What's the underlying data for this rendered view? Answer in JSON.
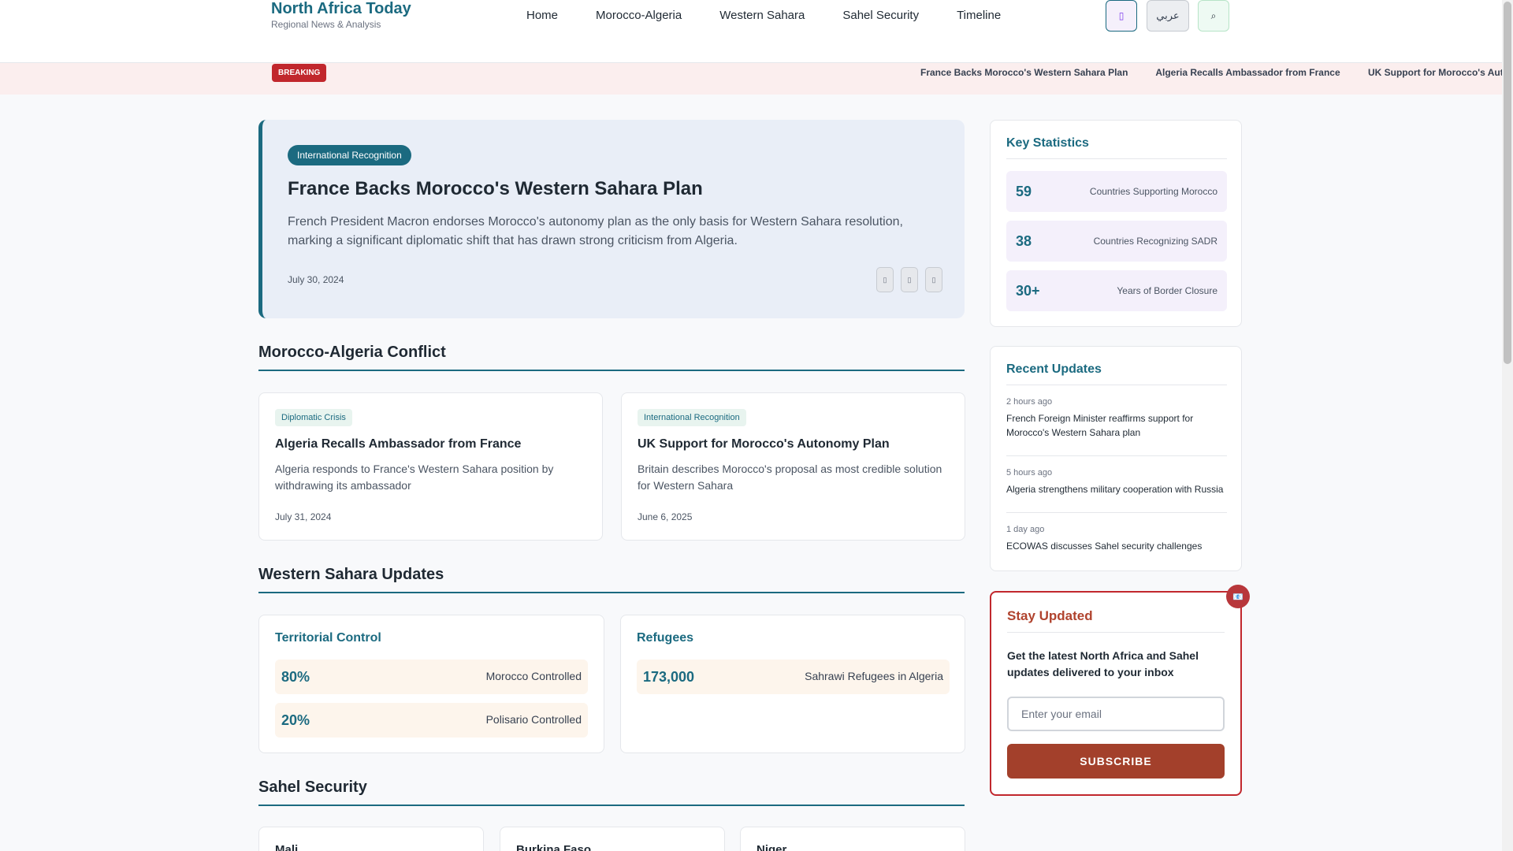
{
  "brand": {
    "title": "North Africa Today",
    "tagline": "Regional News & Analysis"
  },
  "nav": [
    "Home",
    "Morocco-Algeria",
    "Western Sahara",
    "Sahel Security",
    "Timeline"
  ],
  "header_buttons": {
    "theme_icon": "▯",
    "language": "عربي",
    "search_icon": "⌕"
  },
  "breaking": {
    "label": "BREAKING",
    "items": [
      "France Backs Morocco's Western Sahara Plan",
      "Algeria Recalls Ambassador from France",
      "UK Support for Morocco's Autonomy Plan"
    ]
  },
  "hero": {
    "tag": "International Recognition",
    "title": "France Backs Morocco's Western Sahara Plan",
    "description": "French President Macron endorses Morocco's autonomy plan as the only basis for Western Sahara resolution, marking a significant diplomatic shift that has drawn strong criticism from Algeria.",
    "date": "July 30, 2024",
    "share_icons": [
      "▯",
      "▯",
      "▯"
    ]
  },
  "conflict": {
    "title": "Morocco-Algeria Conflict",
    "cards": [
      {
        "tag": "Diplomatic Crisis",
        "title": "Algeria Recalls Ambassador from France",
        "desc": "Algeria responds to France's Western Sahara position by withdrawing its ambassador",
        "date": "July 31, 2024"
      },
      {
        "tag": "International Recognition",
        "title": "UK Support for Morocco's Autonomy Plan",
        "desc": "Britain describes Morocco's proposal as most credible solution for Western Sahara",
        "date": "June 6, 2025"
      }
    ]
  },
  "sahara": {
    "title": "Western Sahara Updates",
    "territorial": {
      "title": "Territorial Control",
      "stats": [
        {
          "value": "80%",
          "label": "Morocco Controlled"
        },
        {
          "value": "20%",
          "label": "Polisario Controlled"
        }
      ]
    },
    "refugees": {
      "title": "Refugees",
      "stats": [
        {
          "value": "173,000",
          "label": "Sahrawi Refugees in Algeria"
        }
      ]
    }
  },
  "sahel": {
    "title": "Sahel Security",
    "countries": [
      "Mali",
      "Burkina Faso",
      "Niger"
    ]
  },
  "key_stats": {
    "title": "Key Statistics",
    "items": [
      {
        "value": "59",
        "label": "Countries Supporting Morocco"
      },
      {
        "value": "38",
        "label": "Countries Recognizing SADR"
      },
      {
        "value": "30+",
        "label": "Years of Border Closure"
      }
    ]
  },
  "recent_updates": {
    "title": "Recent Updates",
    "items": [
      {
        "time": "2 hours ago",
        "text": "French Foreign Minister reaffirms support for Morocco's Western Sahara plan"
      },
      {
        "time": "5 hours ago",
        "text": "Algeria strengthens military cooperation with Russia"
      },
      {
        "time": "1 day ago",
        "text": "ECOWAS discusses Sahel security challenges"
      }
    ]
  },
  "newsletter": {
    "icon": "📧",
    "title": "Stay Updated",
    "desc": "Get the latest North Africa and Sahel updates delivered to your inbox",
    "placeholder": "Enter your email",
    "button": "SUBSCRIBE"
  }
}
